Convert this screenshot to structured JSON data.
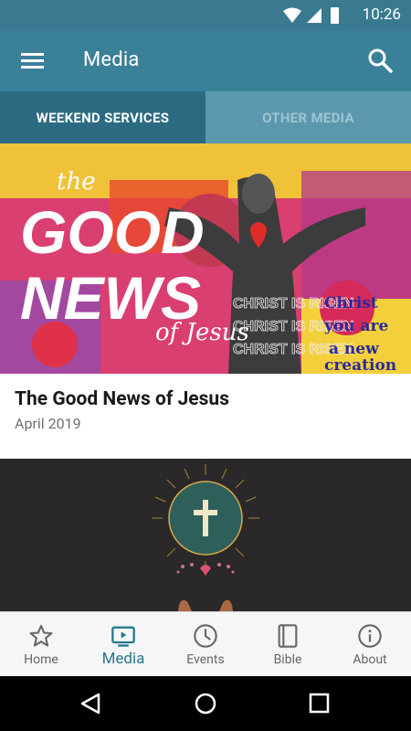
{
  "status_bar": {
    "time": "10:26"
  },
  "app_bar": {
    "title": "Media"
  },
  "tabs": [
    {
      "label": "WEEKEND SERVICES",
      "active": true
    },
    {
      "label": "OTHER MEDIA",
      "active": false
    }
  ],
  "cards": [
    {
      "title": "The Good News of Jesus",
      "subtitle": "April 2019"
    }
  ],
  "bottom_nav": [
    {
      "label": "Home",
      "icon": "star-icon"
    },
    {
      "label": "Media",
      "icon": "tv-icon",
      "active": true
    },
    {
      "label": "Events",
      "icon": "clock-icon"
    },
    {
      "label": "Bible",
      "icon": "book-icon"
    },
    {
      "label": "About",
      "icon": "info-icon"
    }
  ],
  "colors": {
    "app_bar": "#3b8099",
    "tab_active": "#2c6a82",
    "tab_inactive": "#5b98ae",
    "nav_active": "#247a8f"
  }
}
